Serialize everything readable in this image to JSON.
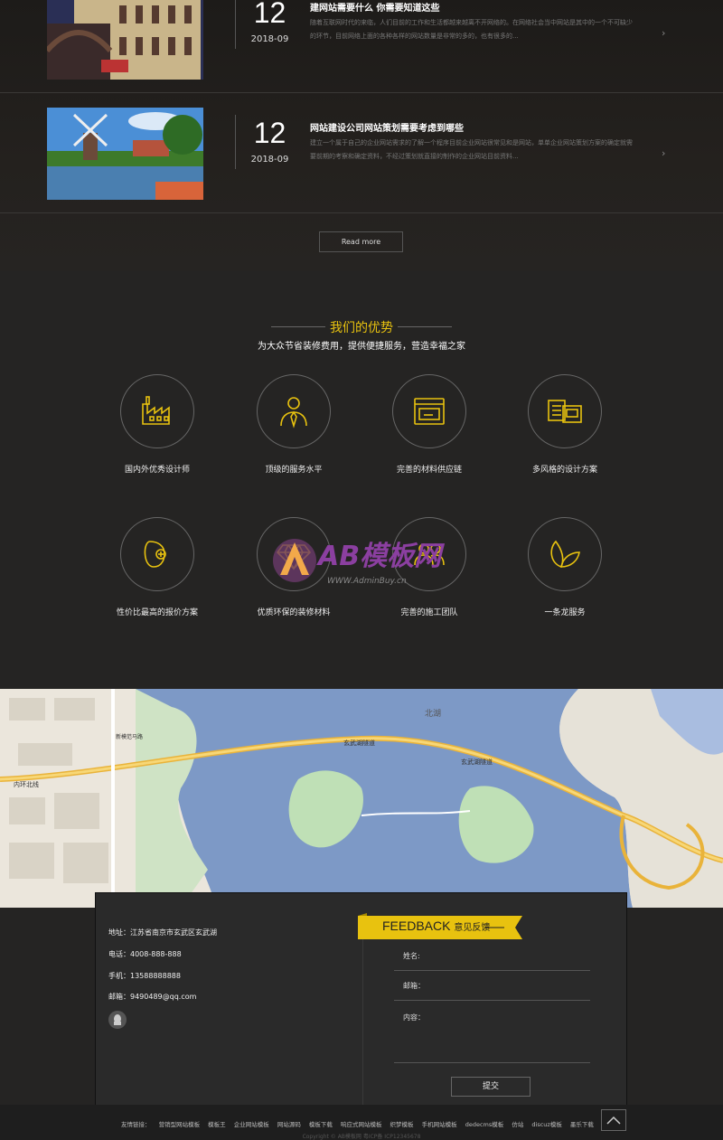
{
  "news": {
    "items": [
      {
        "day": "12",
        "ym": "2018-09",
        "title": "建网站需要什么 你需要知道这些",
        "desc": "随着互联网时代的来临，人们目前的工作和生活都越来越离不开网络的。在网络社会当中网站是其中的一个不可缺少的环节，目前网络上面的各种各样的网站数量是非常的多的，也有很多的..."
      },
      {
        "day": "12",
        "ym": "2018-09",
        "title": "网站建设公司网站策划需要考虑到哪些",
        "desc": "建立一个属于自己的企业网站需求的了解一个程序目前企业网站很常见和是网站，单单企业网站策划方案的确定就需要前期的考察和确定资料，不经过策划就直接的制作的企业网站目前资料..."
      }
    ],
    "arrow": "›",
    "read_more": "Read more"
  },
  "advantages": {
    "title": "我们的优势",
    "subtitle": "为大众节省装修费用，提供便捷服务，营造幸福之家",
    "items": [
      {
        "label": "国内外优秀设计师",
        "icon": "factory-icon"
      },
      {
        "label": "顶级的服务水平",
        "icon": "person-icon"
      },
      {
        "label": "完善的材料供应链",
        "icon": "oven-icon"
      },
      {
        "label": "多风格的设计方案",
        "icon": "documents-icon"
      },
      {
        "label": "性价比最高的报价方案",
        "icon": "price-tag-icon"
      },
      {
        "label": "优质环保的装修材料",
        "icon": "diamond-icon"
      },
      {
        "label": "完善的施工团队",
        "icon": "team-icon"
      },
      {
        "label": "一条龙服务",
        "icon": "leaves-icon"
      }
    ]
  },
  "watermark": {
    "brand": "AB模板网",
    "url": "WWW.AdminBuy.cn"
  },
  "map": {
    "labels": [
      "北湖",
      "玄武湖隧道",
      "内环北线",
      "新模范马路",
      "玄武湖隧道"
    ]
  },
  "contact": {
    "address": "地址：江苏省南京市玄武区玄武湖",
    "phone": "电话：4008-888-888",
    "mobile": "手机：13588888888",
    "email": "邮箱：9490489@qq.com"
  },
  "feedback": {
    "title_en": "FEEDBACK",
    "title_cn": "意见反馈",
    "name_label": "姓名:",
    "email_label": "邮箱：",
    "content_label": "内容：",
    "submit": "提交"
  },
  "footer": {
    "links": [
      "友情链接：",
      "营销型网站模板",
      "模板王",
      "企业网站模板",
      "网站源码",
      "模板下载",
      "响应式网站模板",
      "织梦模板",
      "手机网站模板",
      "dedecms模板",
      "仿站",
      "discuz模板",
      "墨乐下载"
    ],
    "copyright": "Copyright © AB模板网 粤ICP备 ICP12345678"
  },
  "colors": {
    "accent": "#e8c20f",
    "background": "#252423"
  }
}
